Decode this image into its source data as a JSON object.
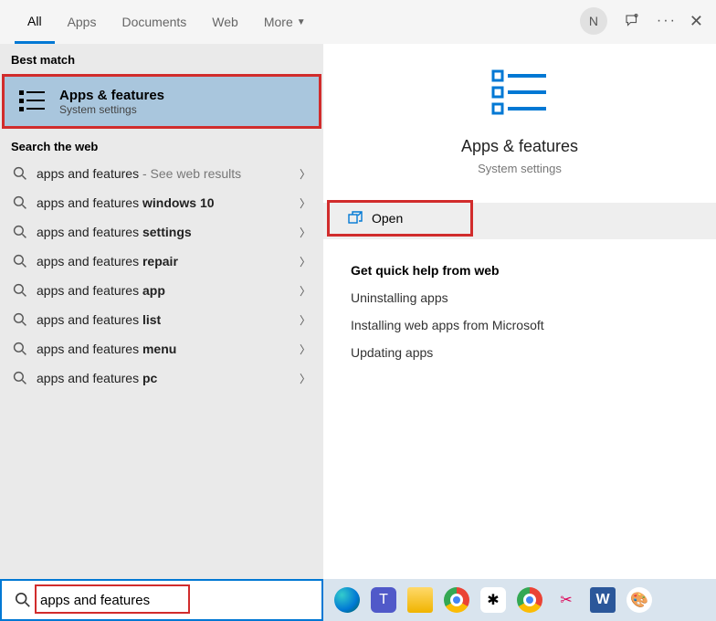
{
  "tabs": {
    "all": "All",
    "apps": "Apps",
    "documents": "Documents",
    "web": "Web",
    "more": "More"
  },
  "avatar_initial": "N",
  "sections": {
    "best_match": "Best match",
    "search_web": "Search the web"
  },
  "best_match": {
    "title": "Apps & features",
    "subtitle": "System settings"
  },
  "web_results": [
    {
      "prefix": "apps and features",
      "bold": "",
      "suffix": " - See web results"
    },
    {
      "prefix": "apps and features ",
      "bold": "windows 10",
      "suffix": ""
    },
    {
      "prefix": "apps and features ",
      "bold": "settings",
      "suffix": ""
    },
    {
      "prefix": "apps and features ",
      "bold": "repair",
      "suffix": ""
    },
    {
      "prefix": "apps and features ",
      "bold": "app",
      "suffix": ""
    },
    {
      "prefix": "apps and features ",
      "bold": "list",
      "suffix": ""
    },
    {
      "prefix": "apps and features ",
      "bold": "menu",
      "suffix": ""
    },
    {
      "prefix": "apps and features ",
      "bold": "pc",
      "suffix": ""
    }
  ],
  "preview": {
    "title": "Apps & features",
    "subtitle": "System settings",
    "open": "Open"
  },
  "quick_help": {
    "heading": "Get quick help from web",
    "links": [
      "Uninstalling apps",
      "Installing web apps from Microsoft",
      "Updating apps"
    ]
  },
  "search_value": "apps and features",
  "taskbar_icons": [
    "edge",
    "teams",
    "explorer",
    "chrome",
    "slack",
    "chrome2",
    "snip",
    "word",
    "paint"
  ]
}
